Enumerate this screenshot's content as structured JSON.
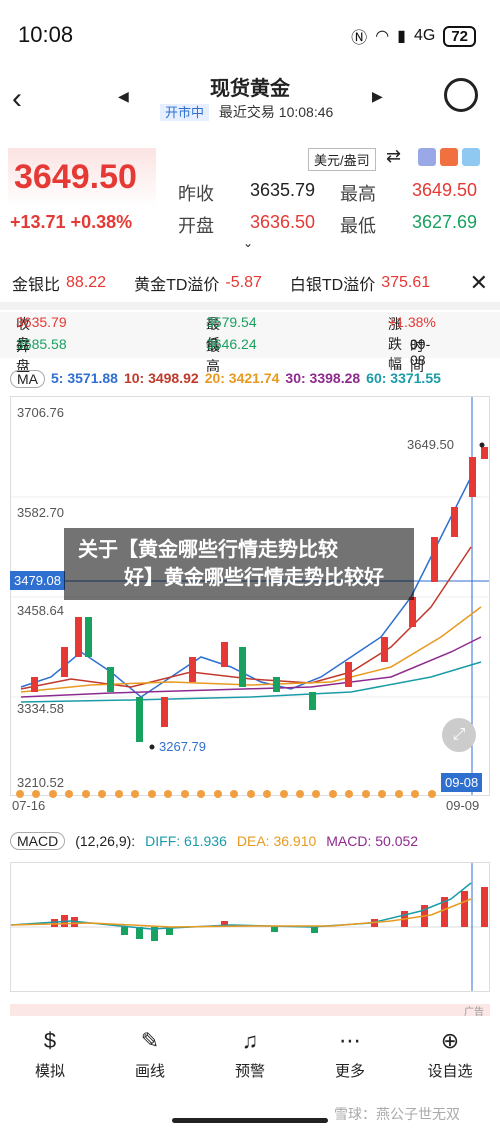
{
  "status": {
    "time": "10:08",
    "signal": "4G",
    "battery": "72"
  },
  "header": {
    "title": "现货黄金",
    "market_status": "开市中",
    "last_trade": "最近交易 10:08:46"
  },
  "quote": {
    "price": "3649.50",
    "change": "+13.71 +0.38%",
    "currency": "美元/盎司",
    "prev_close_label": "昨收",
    "prev_close": "3635.79",
    "high_label": "最高",
    "high": "3649.50",
    "open_label": "开盘",
    "open": "3636.50",
    "low_label": "最低",
    "low": "3627.69"
  },
  "ratios": {
    "gold_silver_label": "金银比",
    "gold_silver": "88.22",
    "gold_td_label": "黄金TD溢价",
    "gold_td": "-5.87",
    "silver_td_label": "白银TD溢价",
    "silver_td": "375.61",
    "close_icon": "close-icon"
  },
  "info": {
    "close_label": "收盘",
    "close": "3635.79",
    "low_label": "最低",
    "low": "3579.54",
    "change_pct_label": "涨跌幅",
    "change_pct": "+1.38%",
    "open_label": "开盘",
    "open": "3585.58",
    "high_label": "最高",
    "high": "3646.24",
    "time_label": "时间",
    "time": "09-08"
  },
  "ma": {
    "selector": "MA",
    "ma5": "5: 3571.88",
    "ma10": "10: 3498.92",
    "ma20": "20: 3421.74",
    "ma30": "30: 3398.28",
    "ma60": "60: 3371.55"
  },
  "chart_labels": {
    "y_top": "3706.76",
    "y_2": "3582.70",
    "y_3": "3458.64",
    "y_4": "3334.58",
    "y_bottom": "3210.52",
    "x_start": "07-16",
    "x_end": "09-09",
    "price_marker": "3479.08",
    "date_marker": "09-08",
    "high_mark": "3649.50",
    "low_mark": "3267.79"
  },
  "overlay": {
    "line1": "关于【黄金哪些行情走势比较",
    "line2": "好】黄金哪些行情走势比较好"
  },
  "macd": {
    "selector": "MACD",
    "params": "(12,26,9):",
    "diff": "DIFF: 61.936",
    "dea": "DEA: 36.910",
    "macd": "MACD: 50.052"
  },
  "ad": {
    "label": "广告"
  },
  "nav": [
    {
      "label": "模拟",
      "icon": "dollar-icon"
    },
    {
      "label": "画线",
      "icon": "pen-icon"
    },
    {
      "label": "预警",
      "icon": "bell-icon"
    },
    {
      "label": "更多",
      "icon": "more-icon"
    },
    {
      "label": "设自选",
      "icon": "add-icon"
    }
  ],
  "watermark": "雪球：燕公子世无双"
}
